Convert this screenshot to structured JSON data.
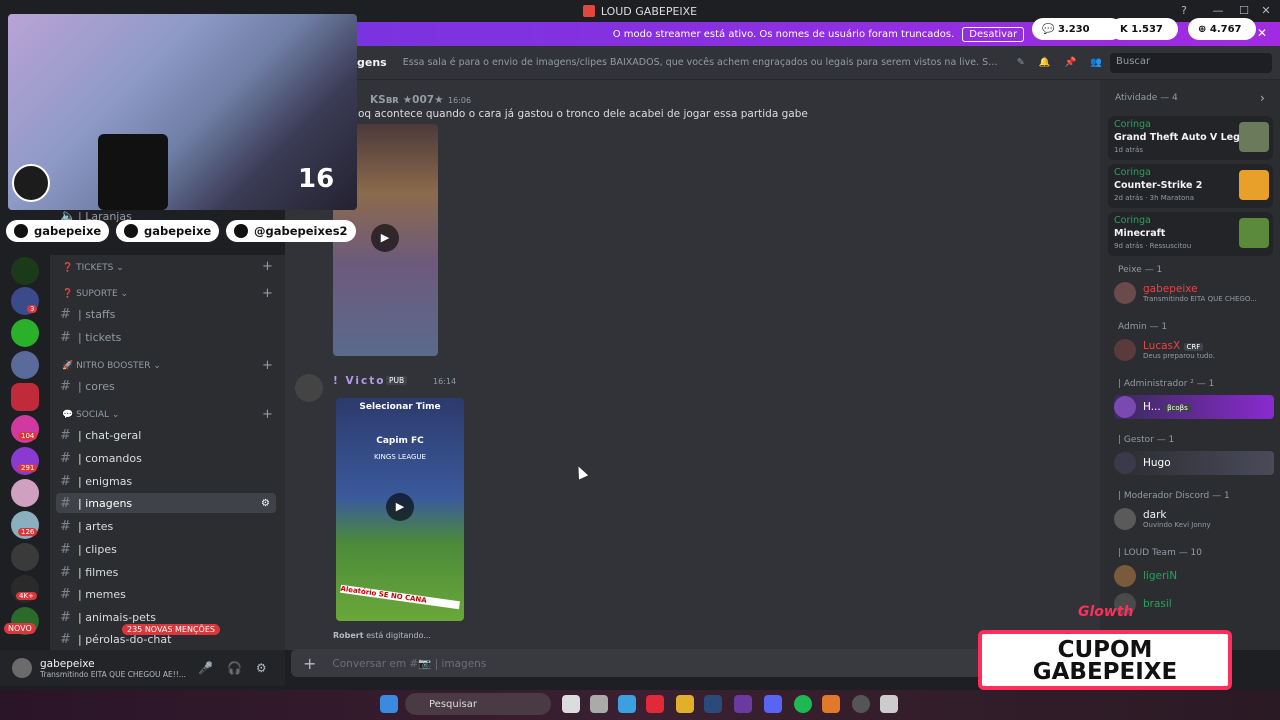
{
  "window": {
    "title": "LOUD GABEPEIXE"
  },
  "banner": {
    "text": "O modo streamer está ativo. Os nomes de usuário foram truncados.",
    "button": "Desativar"
  },
  "stats": {
    "a": "3.230",
    "b": "1.537",
    "c": "4.767"
  },
  "header": {
    "channel": "gens",
    "topic": "Essa sala é para o envio de imagens/clipes BAIXADOS, que vocês achem engraçados ou legais para serem vistos na live. Serão apagados prints de ou...",
    "search_placeholder": "Buscar"
  },
  "overlay": {
    "cam_number": "16",
    "social1": "gabepeixe",
    "social2": "gabepeixe",
    "social3": "@gabepeixes2",
    "cupom_line1": "CUPOM",
    "cupom_line2": "GABEPEIXE",
    "brand": "Glowth"
  },
  "servers": {
    "badges": [
      "3",
      "104",
      "291",
      "126",
      "4K+"
    ]
  },
  "channels": {
    "hidden1": "| Laranjas",
    "cat_tickets": "TICKETS",
    "cat_suporte": "SUPORTE",
    "staffs": "| staffs",
    "tickets": "| tickets",
    "cat_nitro": "NITRO BOOSTER",
    "cores": "| cores",
    "cat_social": "SOCIAL",
    "chat_geral": "| chat-geral",
    "comandos": "| comandos",
    "enigmas": "| enigmas",
    "imagens": "| imagens",
    "artes": "| artes",
    "clipes": "| clipes",
    "filmes": "| filmes",
    "memes": "| memes",
    "animais": "| animais-pets",
    "perolas": "| pérolas-do-chat",
    "novo": "NOVO",
    "mentions": "235 NOVAS MENÇÕES"
  },
  "user": {
    "name": "gabepeixe",
    "status": "Transmitindo EITA QUE CHEGOU AE!!..."
  },
  "messages": [
    {
      "author": "KSʙʀ ★007★",
      "time": "16:06",
      "text": "oq acontece quando o cara já gastou o tronco dele acabei de jogar essa partida gabe"
    },
    {
      "author": "! Victor",
      "tag": "PUB",
      "time": "16:14",
      "media_title": "Selecionar Time",
      "media_team": "Capim FC",
      "media_league": "KINGS LEAGUE",
      "media_bottom": "Aleatório SE NO CANA"
    }
  ],
  "typing": {
    "user": "Robert",
    "text": "está digitando..."
  },
  "composer": {
    "placeholder": "Conversar em #📷 | imagens"
  },
  "members": {
    "activity_header": "Atividade — 4",
    "activities": [
      {
        "who": "Coringa",
        "game": "Grand Theft Auto V Legacy",
        "meta": "1d atrás"
      },
      {
        "who": "Coringa",
        "game": "Counter-Strike 2",
        "meta": "2d atrás · 3h Maratona"
      },
      {
        "who": "Coringa",
        "game": "Minecraft",
        "meta": "9d atrás · Ressuscitou"
      }
    ],
    "groups": [
      {
        "header": "Peixe — 1",
        "name": "gabepeixe",
        "status": "Transmitindo EITA QUE CHEGO...",
        "color": "#ed4245"
      },
      {
        "header": "Admin — 1",
        "name": "LucasX",
        "tag": "CRF",
        "status": "Deus preparou tudo.",
        "color": "#ed4245"
      },
      {
        "header": "| Administrador ² — 1",
        "name": "H...",
        "tag": "βcoβs",
        "color": "#ffffff"
      },
      {
        "header": "| Gestor — 1",
        "name": "Hugo",
        "color": "#ffffff"
      },
      {
        "header": "| Moderador Discord — 1",
        "name": "dark",
        "status": "Ouvindo Kevi Jonny",
        "color": "#f2f3f5"
      },
      {
        "header": "| LOUD Team — 10",
        "name": "ligeriN",
        "color": "#23a55a"
      },
      {
        "name": "brasil",
        "color": "#23a55a"
      }
    ]
  },
  "taskbar": {
    "search": "Pesquisar"
  },
  "colors": {
    "accent": "#5865f2",
    "banner": "#a12be0",
    "green": "#23a55a",
    "red": "#ed4245"
  }
}
